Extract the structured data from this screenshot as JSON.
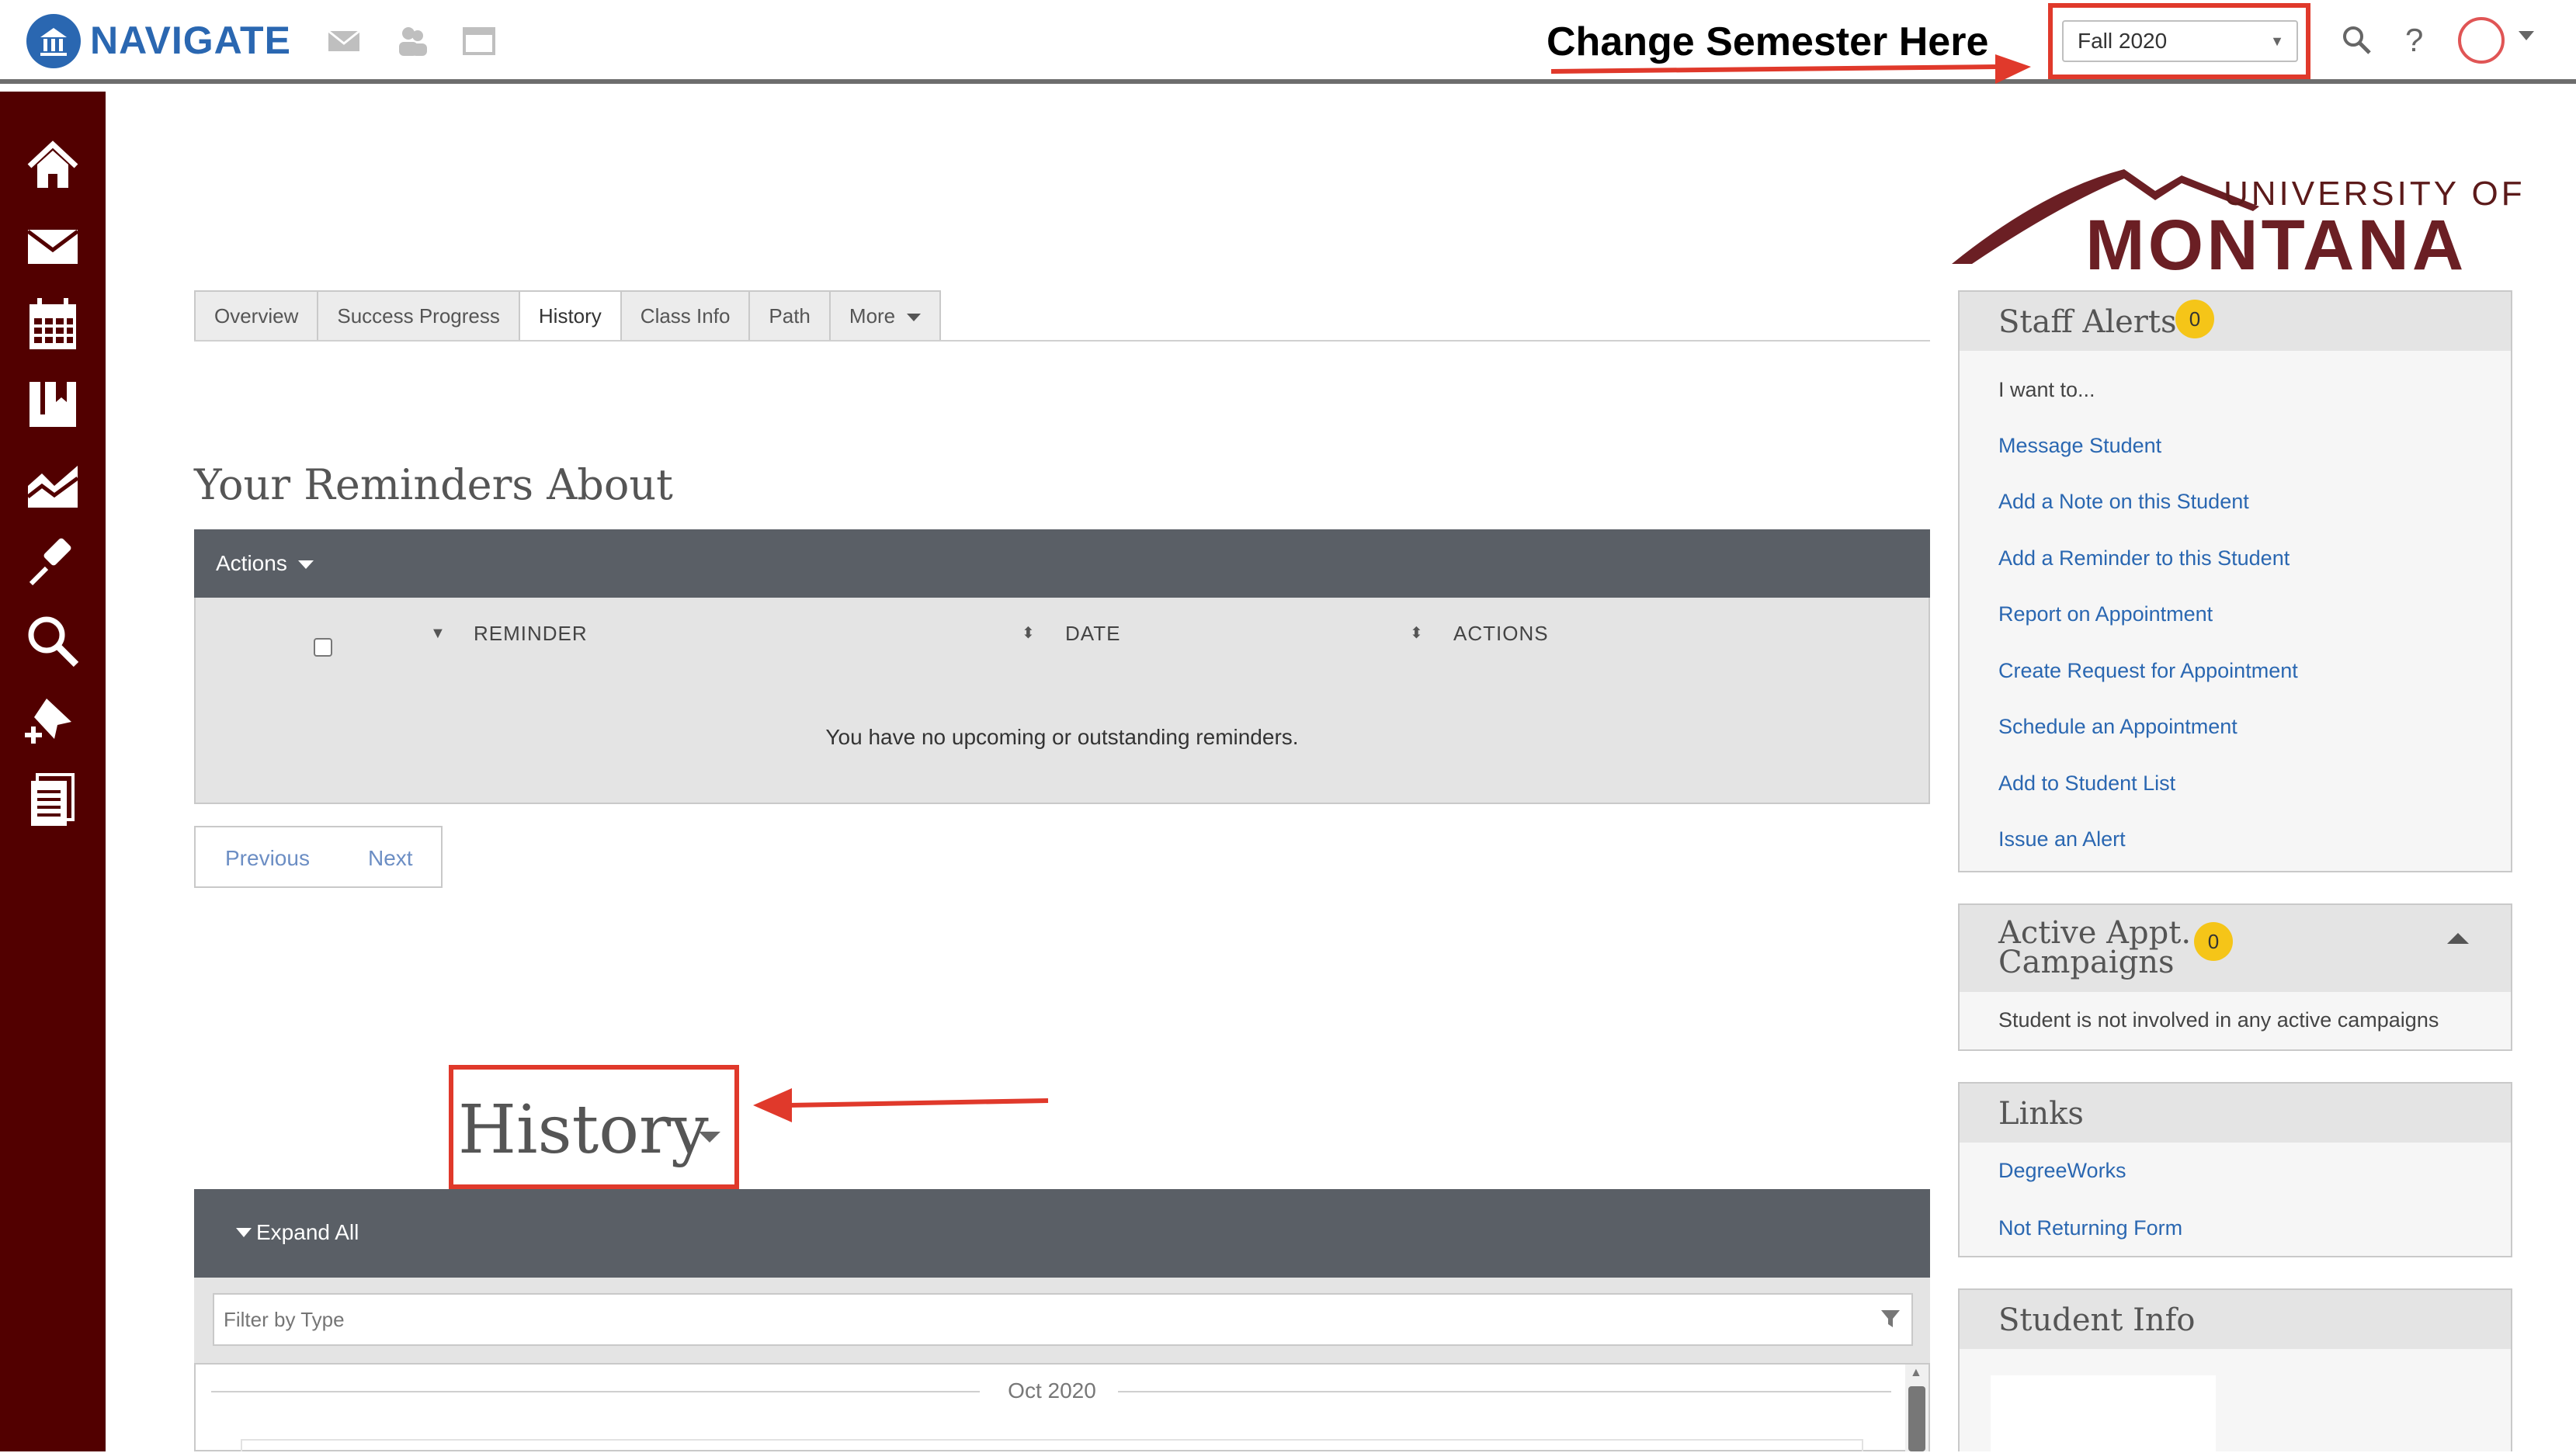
{
  "app": {
    "name": "NAVIGATE"
  },
  "annotation": {
    "text": "Change Semester Here"
  },
  "semester": {
    "value": "Fall 2020"
  },
  "header": {
    "help_label": "?"
  },
  "tabs": [
    {
      "label": "Overview"
    },
    {
      "label": "Success Progress"
    },
    {
      "label": "History"
    },
    {
      "label": "Class Info"
    },
    {
      "label": "Path"
    },
    {
      "label": "More"
    }
  ],
  "reminders": {
    "title": "Your Reminders About",
    "actions_label": "Actions",
    "columns": {
      "reminder": "REMINDER",
      "date": "DATE",
      "actions": "ACTIONS"
    },
    "empty_message": "You have no upcoming or outstanding reminders.",
    "pager": {
      "previous": "Previous",
      "next": "Next"
    }
  },
  "history": {
    "title": "History",
    "expand_label": "Expand All",
    "filter_placeholder": "Filter by Type",
    "timeline_label": "Oct 2020"
  },
  "university": {
    "line1": "UNIVERSITY OF",
    "line2": "MONTANA"
  },
  "staff_alerts": {
    "title": "Staff Alerts",
    "count": "0",
    "prompt": "I want to...",
    "links": [
      "Message Student",
      "Add a Note on this Student",
      "Add a Reminder to this Student",
      "Report on Appointment",
      "Create Request for Appointment",
      "Schedule an Appointment",
      "Add to Student List",
      "Issue an Alert"
    ]
  },
  "campaigns": {
    "title_line1": "Active Appt.",
    "title_line2": "Campaigns",
    "count": "0",
    "message": "Student is not involved in any active campaigns"
  },
  "links_card": {
    "title": "Links",
    "links": [
      "DegreeWorks",
      "Not Returning Form"
    ]
  },
  "student_info": {
    "title": "Student Info"
  },
  "colors": {
    "brand_blue": "#2a67b1",
    "sidebar_maroon": "#520000",
    "annotation_red": "#e0392b",
    "badge_yellow": "#f5c518"
  }
}
